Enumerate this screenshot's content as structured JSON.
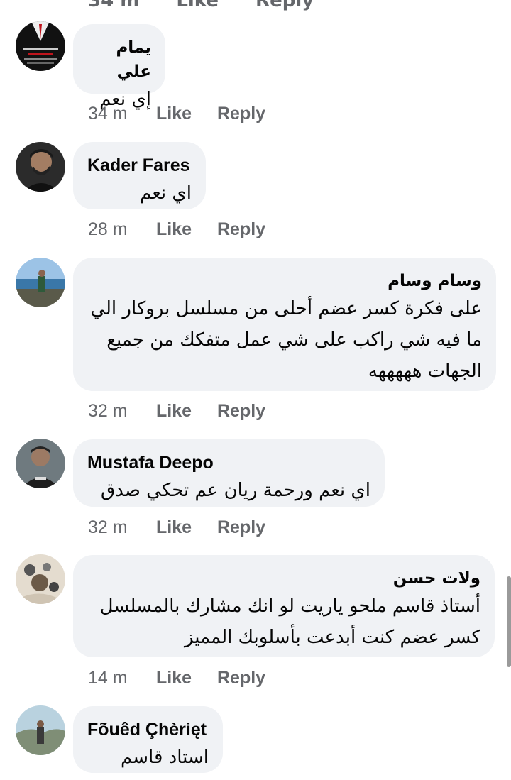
{
  "top_partial": {
    "time": "34 m",
    "like": "Like",
    "reply": "Reply"
  },
  "comments": [
    {
      "author": "يمام علي",
      "text": "إي نعم",
      "time": "34 m",
      "like": "Like",
      "reply": "Reply"
    },
    {
      "author": "Kader Fares",
      "text": "اي نعم",
      "time": "28 m",
      "like": "Like",
      "reply": "Reply"
    },
    {
      "author": "وسام وسام",
      "text_lines": [
        "على فكرة كسر عضم أحلى من مسلسل بروكار الي",
        "ما فيه شي راكب على شي عمل متفكك من جميع",
        "الجهات هههههه"
      ],
      "time": "32 m",
      "like": "Like",
      "reply": "Reply"
    },
    {
      "author": "Mustafa Deepo",
      "text": "اي نعم ورحمة ريان عم تحكي صدق",
      "time": "32 m",
      "like": "Like",
      "reply": "Reply"
    },
    {
      "author": "ولات حسن",
      "text_lines": [
        "أستاذ قاسم ملحو ياريت لو انك مشارك بالمسلسل",
        "كسر عضم كنت أبدعت بأسلوبك المميز"
      ],
      "time": "14 m",
      "like": "Like",
      "reply": "Reply"
    },
    {
      "author": "Fõuêd Çhèrięt",
      "text": "استاد قاسم"
    }
  ],
  "colors": {
    "bubble": "#f0f2f5",
    "meta": "#65676b",
    "text": "#050505"
  }
}
